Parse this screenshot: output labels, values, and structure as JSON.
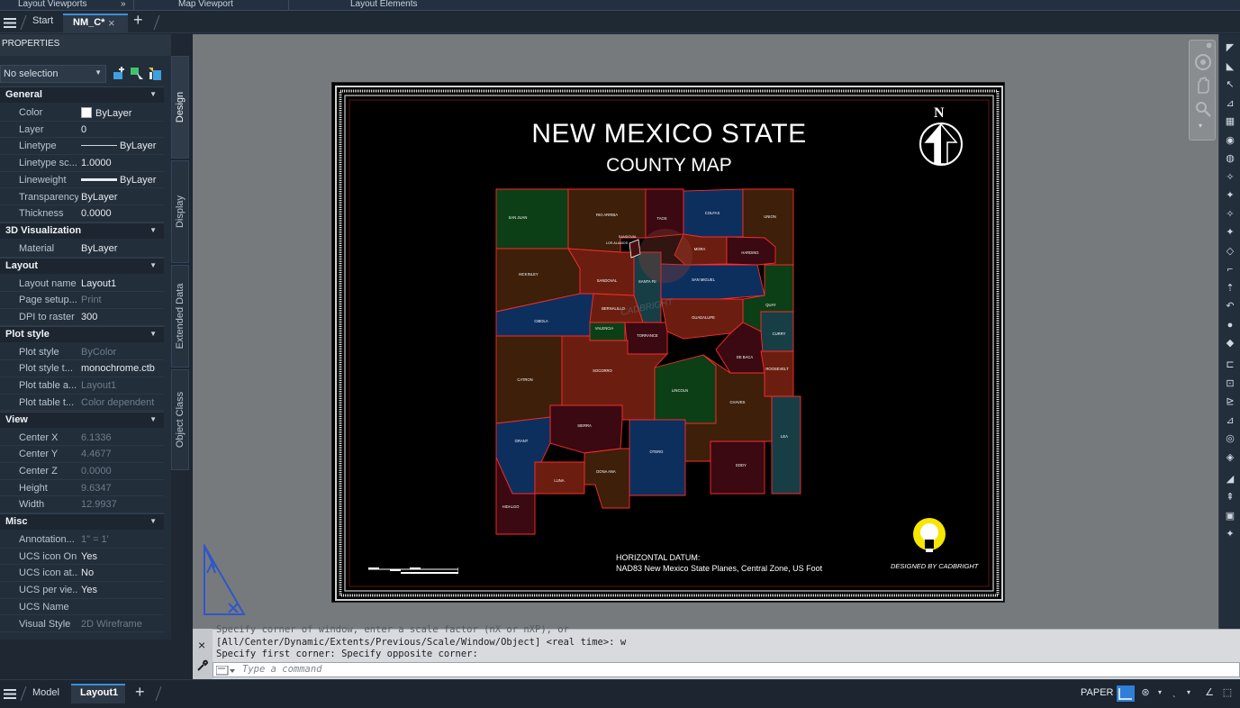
{
  "ribbon": {
    "panels": [
      "Layout Viewports",
      "Map Viewport",
      "Layout Elements"
    ],
    "expand_glyph": "»"
  },
  "tabs": {
    "menu_icon": "hamburger-icon",
    "start": "Start",
    "active": "NM_C*",
    "close_glyph": "×",
    "add_glyph": "+"
  },
  "properties": {
    "title": "PROPERTIES",
    "selection": "No selection",
    "sections": {
      "general": {
        "title": "General",
        "rows": [
          {
            "key": "Color",
            "value": "ByLayer"
          },
          {
            "key": "Layer",
            "value": "0"
          },
          {
            "key": "Linetype",
            "value": "ByLayer"
          },
          {
            "key": "Linetype sc...",
            "value": "1.0000"
          },
          {
            "key": "Lineweight",
            "value": "ByLayer"
          },
          {
            "key": "Transparency",
            "value": "ByLayer"
          },
          {
            "key": "Thickness",
            "value": "0.0000"
          }
        ]
      },
      "visualization": {
        "title": "3D Visualization",
        "rows": [
          {
            "key": "Material",
            "value": "ByLayer"
          }
        ]
      },
      "layout": {
        "title": "Layout",
        "rows": [
          {
            "key": "Layout name",
            "value": "Layout1"
          },
          {
            "key": "Page setup...",
            "value": "Print"
          },
          {
            "key": "DPI to raster",
            "value": "300"
          }
        ]
      },
      "plot_style": {
        "title": "Plot style",
        "rows": [
          {
            "key": "Plot style",
            "value": "ByColor"
          },
          {
            "key": "Plot style t...",
            "value": "monochrome.ctb"
          },
          {
            "key": "Plot table a...",
            "value": "Layout1"
          },
          {
            "key": "Plot table t...",
            "value": "Color dependent"
          }
        ]
      },
      "view": {
        "title": "View",
        "rows": [
          {
            "key": "Center X",
            "value": "6.1336"
          },
          {
            "key": "Center Y",
            "value": "4.4677"
          },
          {
            "key": "Center Z",
            "value": "0.0000"
          },
          {
            "key": "Height",
            "value": "9.6347"
          },
          {
            "key": "Width",
            "value": "12.9937"
          }
        ]
      },
      "misc": {
        "title": "Misc",
        "rows": [
          {
            "key": "Annotation...",
            "value": "1\" = 1'"
          },
          {
            "key": "UCS icon On",
            "value": "Yes"
          },
          {
            "key": "UCS icon at...",
            "value": "No"
          },
          {
            "key": "UCS per vie...",
            "value": "Yes"
          },
          {
            "key": "UCS Name",
            "value": ""
          },
          {
            "key": "Visual Style",
            "value": "2D Wireframe"
          }
        ]
      }
    },
    "side_tabs": [
      "Design",
      "Display",
      "Extended Data",
      "Object Class"
    ]
  },
  "drawing": {
    "title": "NEW MEXICO STATE",
    "subtitle": "COUNTY MAP",
    "north_label": "N",
    "datum_label": "HORIZONTAL DATUM:",
    "datum_value": "NAD83 New Mexico State Planes, Central Zone, US Foot",
    "designer": "DESIGNED BY CADBRIGHT",
    "watermark": "CADBRIGHT",
    "counties": {
      "san_juan": "SAN JUAN",
      "rio_arriba": "RIO ARRIBA",
      "taos": "TAOS",
      "colfax": "COLFAX",
      "union": "UNION",
      "los_alamos": "LOS ALAMOS",
      "sandoval_small": "SANDOVAL",
      "mora": "MORA",
      "harding": "HARDING",
      "mckinley": "MCKINLEY",
      "sandoval": "SANDOVAL",
      "santa_fe": "SANTA FE",
      "san_miguel": "SAN MIGUEL",
      "quay": "QUAY",
      "cibola": "CIBOLA",
      "bernalillo": "BERNALILLO",
      "valencia": "VALENCIA",
      "torrance": "TORRANCE",
      "guadalupe": "GUADALUPE",
      "curry": "CURRY",
      "de_baca": "DE BACA",
      "roosevelt": "ROOSEVELT",
      "catron": "CATRON",
      "socorro": "SOCORRO",
      "lincoln": "LINCOLN",
      "chaves": "CHAVES",
      "sierra": "SIERRA",
      "grant": "GRANT",
      "otero": "OTERO",
      "lea": "LEA",
      "dona_ana": "DONA ANA",
      "luna": "LUNA",
      "eddy": "EDDY",
      "hidalgo": "HIDALGO"
    },
    "colors": {
      "maroon": "#3a0912",
      "rust": "#6b1e10",
      "green": "#0c3f16",
      "blue": "#0d2f5e",
      "teal": "#173e45",
      "brown": "#3d1f0a",
      "border": "#ff2a2a"
    }
  },
  "command": {
    "history_1": "Specify corner of window, enter a scale factor (nX or nXP), or",
    "history_2": "[All/Center/Dynamic/Extents/Previous/Scale/Window/Object] <real time>: w",
    "history_3": "Specify first corner: Specify opposite corner:",
    "placeholder": "Type a command",
    "close_glyph": "×"
  },
  "status": {
    "model": "Model",
    "layout1": "Layout1",
    "add_glyph": "+",
    "paper": "PAPER"
  }
}
